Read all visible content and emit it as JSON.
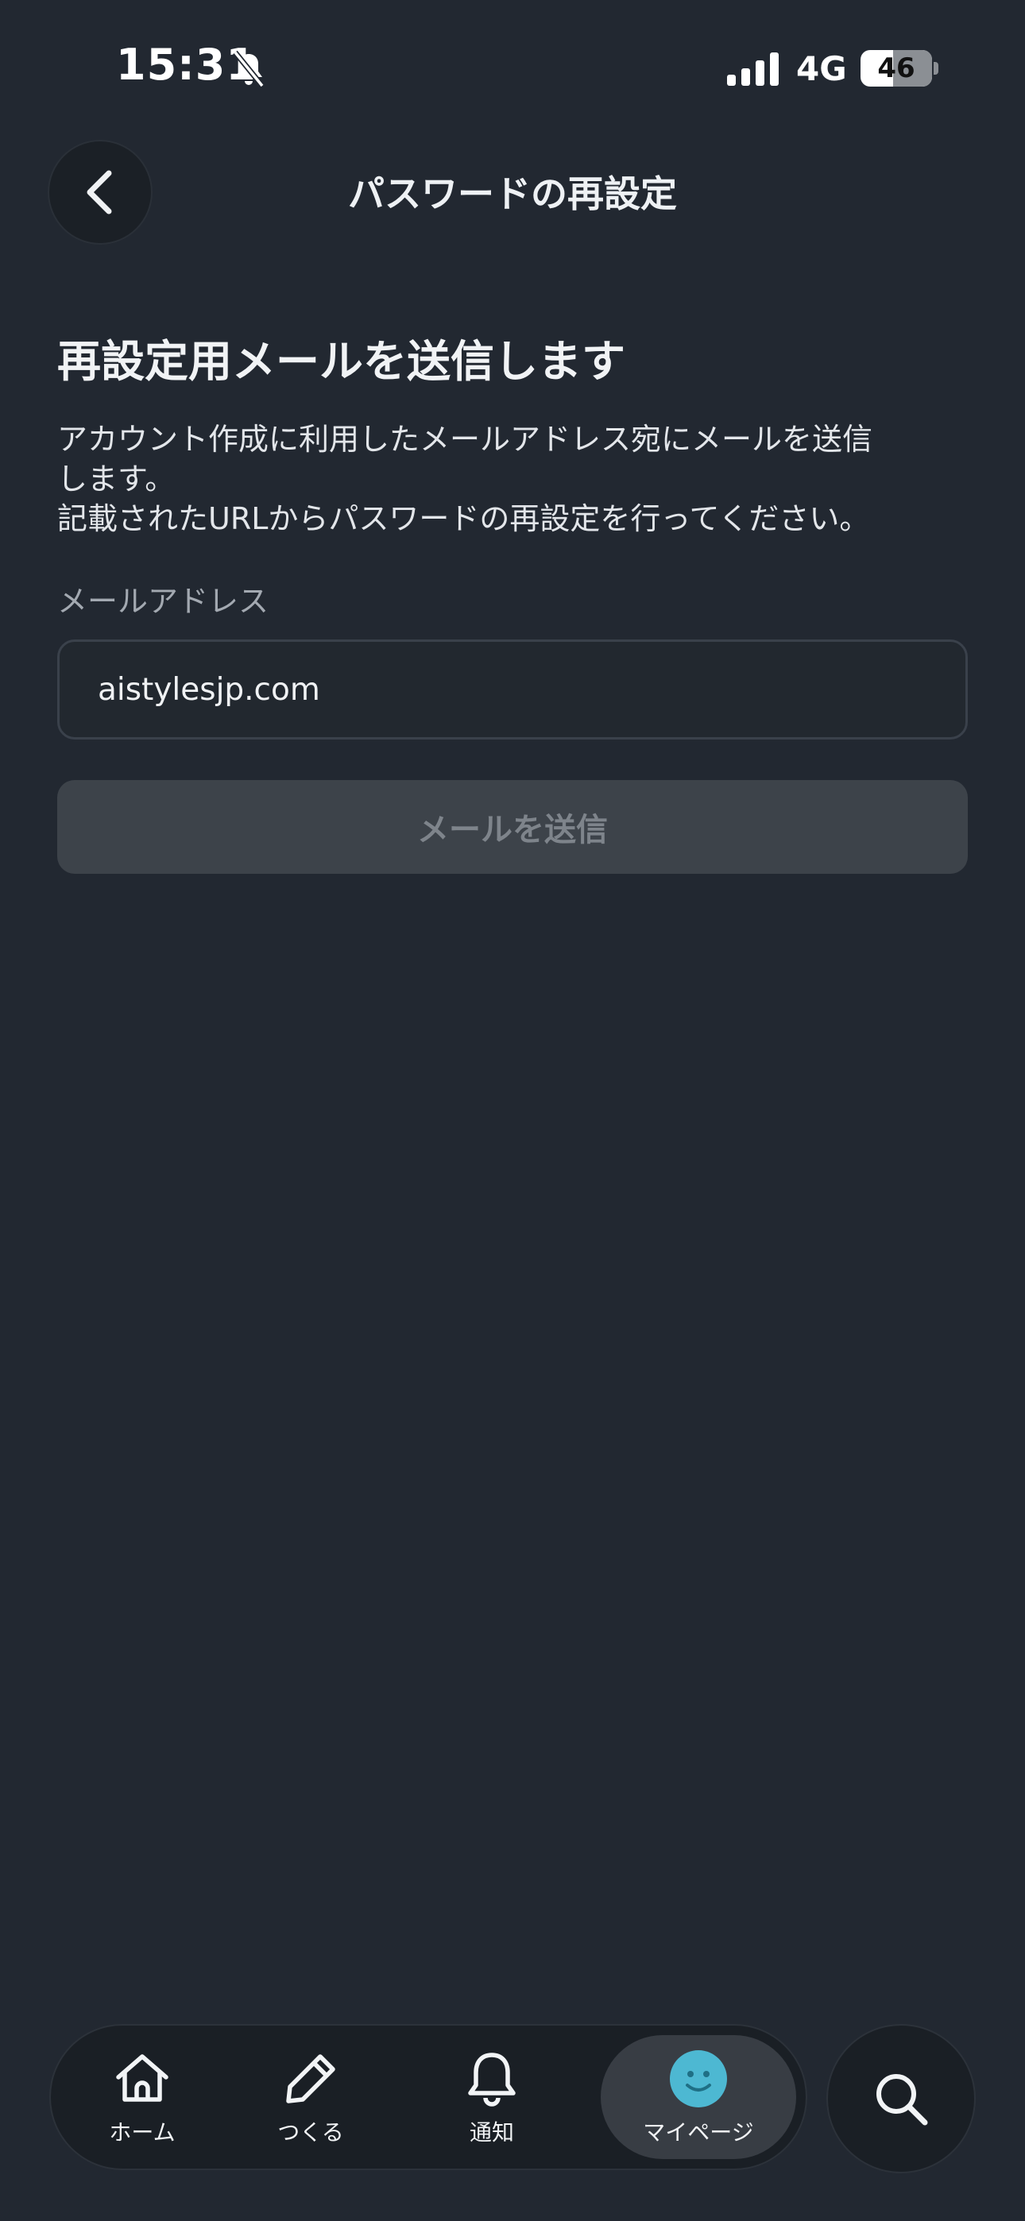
{
  "status_bar": {
    "time": "15:31",
    "network": "4G",
    "battery": "46",
    "battery_level_percent": 46,
    "icons": [
      "bell-slash-icon",
      "signal-icon"
    ]
  },
  "header": {
    "title": "パスワードの再設定",
    "back_icon": "chevron-left-icon"
  },
  "main": {
    "heading": "再設定用メールを送信します",
    "description_lines": [
      "アカウント作成に利用したメールアドレス宛にメールを送信",
      "します。",
      "記載されたURLからパスワードの再設定を行ってください。"
    ],
    "email_label": "メールアドレス",
    "email_value": "aistylesjp.com",
    "send_button": "メールを送信"
  },
  "bottom_nav": {
    "tabs": [
      {
        "label": "ホーム",
        "icon": "home-icon"
      },
      {
        "label": "つくる",
        "icon": "pencil-icon"
      },
      {
        "label": "通知",
        "icon": "bell-icon"
      },
      {
        "label": "マイページ",
        "icon": "smiley-avatar-icon"
      }
    ],
    "active_tab": "マイページ",
    "search_icon": "search-icon"
  },
  "colors": {
    "background": "#222831",
    "button_disabled": "#3d434a",
    "avatar_accent": "#4db8d2"
  }
}
